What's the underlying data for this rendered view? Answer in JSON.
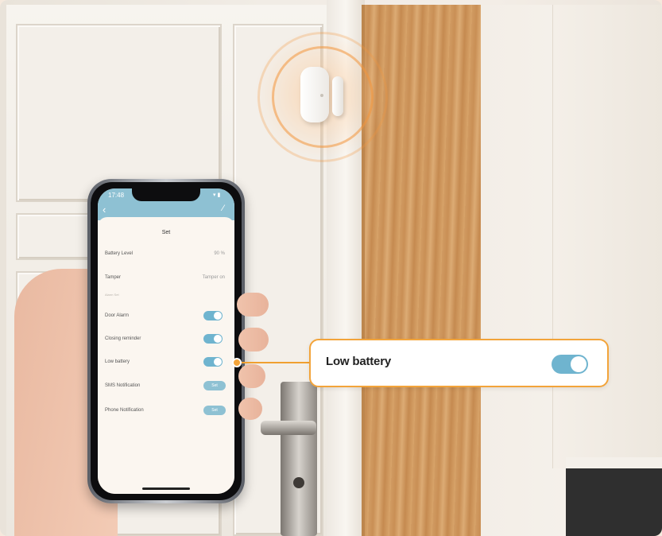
{
  "phone": {
    "status_time": "17:48",
    "status_icons": "▾ ▮",
    "back_icon": "‹",
    "edit_icon": "⁄",
    "title": "Set",
    "rows": {
      "battery_level": {
        "label": "Battery Level",
        "value": "90 %"
      },
      "tamper": {
        "label": "Tamper",
        "value": "Tamper on"
      },
      "section_label": "Alarm Set",
      "door_alarm": {
        "label": "Door Alarm",
        "on": true
      },
      "closing_reminder": {
        "label": "Closing reminder",
        "on": true
      },
      "low_battery": {
        "label": "Low battery",
        "on": true
      },
      "sms_notification": {
        "label": "SMS Notification",
        "button": "Set"
      },
      "phone_notification": {
        "label": "Phone Notification",
        "button": "Set"
      }
    }
  },
  "callout": {
    "label": "Low battery",
    "toggle_on": true
  },
  "colors": {
    "accent_orange": "#f3a43a",
    "toggle_blue": "#6fb4cf",
    "header_blue": "#8ec1d3"
  },
  "icons": {
    "sensor": "door-sensor-icon",
    "back": "back-arrow-icon",
    "edit": "edit-icon"
  }
}
